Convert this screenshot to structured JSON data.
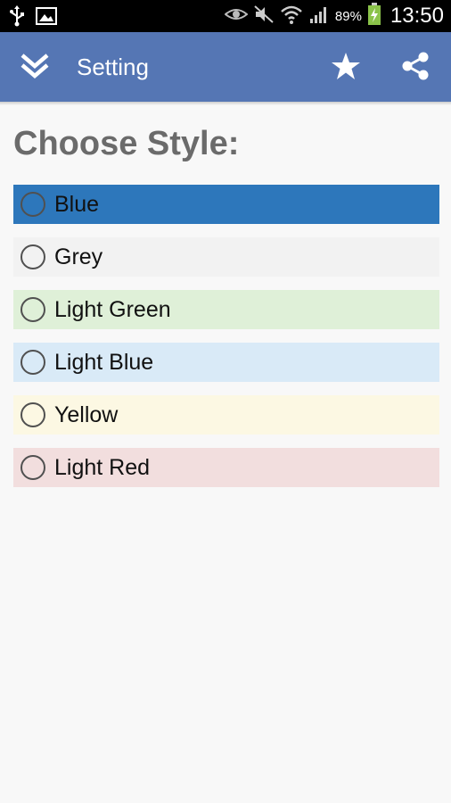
{
  "status_bar": {
    "battery_percent": "89%",
    "time": "13:50",
    "icons": [
      "usb-icon",
      "image-icon",
      "eye-icon",
      "mute-icon",
      "wifi-icon",
      "signal-icon",
      "battery-charging-icon"
    ]
  },
  "action_bar": {
    "title": "Setting",
    "color": "#5576b4",
    "icons": [
      "double-chevron-down-icon",
      "star-icon",
      "share-icon"
    ]
  },
  "heading": "Choose Style:",
  "styles": [
    {
      "label": "Blue",
      "color": "#2d77bb",
      "selected": false
    },
    {
      "label": "Grey",
      "color": "#f2f2f2",
      "selected": false
    },
    {
      "label": "Light Green",
      "color": "#dff0d8",
      "selected": false
    },
    {
      "label": "Light Blue",
      "color": "#d9eaf7",
      "selected": false
    },
    {
      "label": "Yellow",
      "color": "#fcf8e3",
      "selected": false
    },
    {
      "label": "Light Red",
      "color": "#f2dede",
      "selected": false
    }
  ]
}
